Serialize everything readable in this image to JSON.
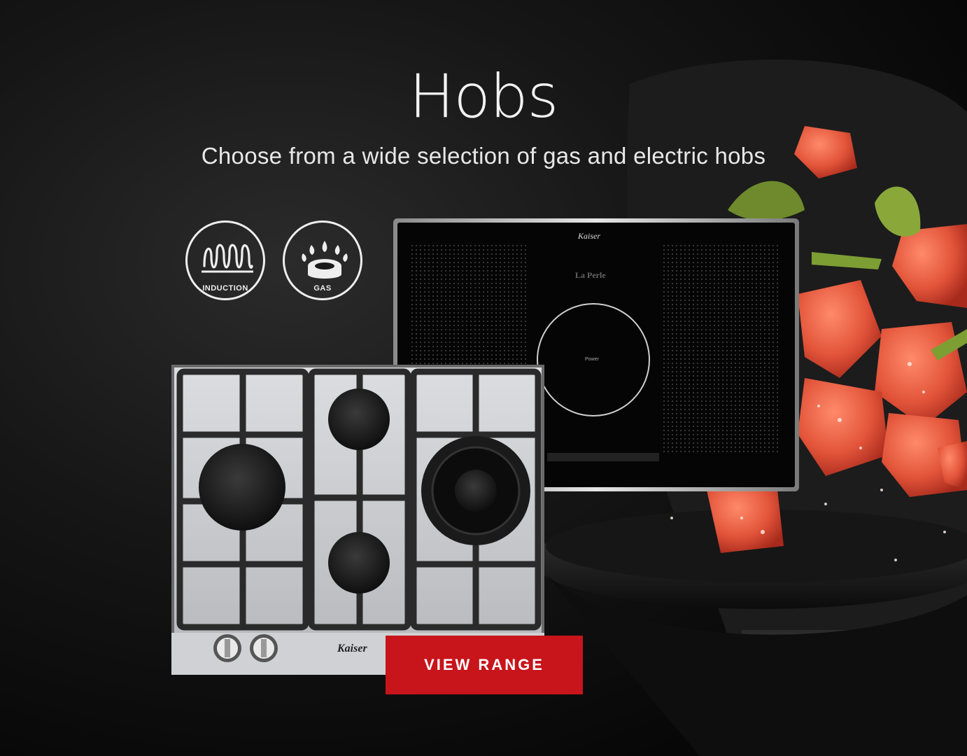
{
  "hero": {
    "title": "Hobs",
    "subtitle": "Choose from a wide selection of gas and electric hobs",
    "cta_label": "VIEW RANGE"
  },
  "badges": [
    {
      "label": "INDUCTION",
      "icon": "induction-coil-icon"
    },
    {
      "label": "GAS",
      "icon": "gas-burner-icon"
    }
  ],
  "products": {
    "induction_hob": {
      "brand": "Kaiser",
      "model": "La Perle",
      "zone_label": "Power"
    },
    "gas_hob": {
      "brand": "Kaiser"
    }
  },
  "colors": {
    "cta": "#c8141b",
    "background": "#0b0b0b",
    "salmon": "#e2543a"
  }
}
